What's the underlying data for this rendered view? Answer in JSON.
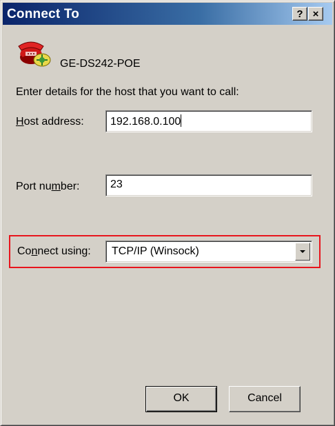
{
  "window": {
    "title": "Connect To",
    "help_button": "?",
    "close_button": "×"
  },
  "connection": {
    "name": "GE-DS242-POE",
    "icon": "phone-connection-icon"
  },
  "instruction": "Enter details for the host that you want to call:",
  "host_address": {
    "label_prefix": "",
    "label_mnemonic": "H",
    "label_rest": "ost address:",
    "value": "192.168.0.100"
  },
  "port_number": {
    "label_prefix": "Port nu",
    "label_mnemonic": "m",
    "label_rest": "ber:",
    "value": "23"
  },
  "connect_using": {
    "label_prefix": "Co",
    "label_mnemonic": "n",
    "label_rest": "nect using:",
    "value": "TCP/IP (Winsock)",
    "highlight_color": "#e8141c"
  },
  "buttons": {
    "ok": "OK",
    "cancel": "Cancel"
  },
  "colors": {
    "dialog_bg": "#d4d0c8",
    "titlebar_start": "#0a246a",
    "titlebar_end": "#a6caf0"
  }
}
